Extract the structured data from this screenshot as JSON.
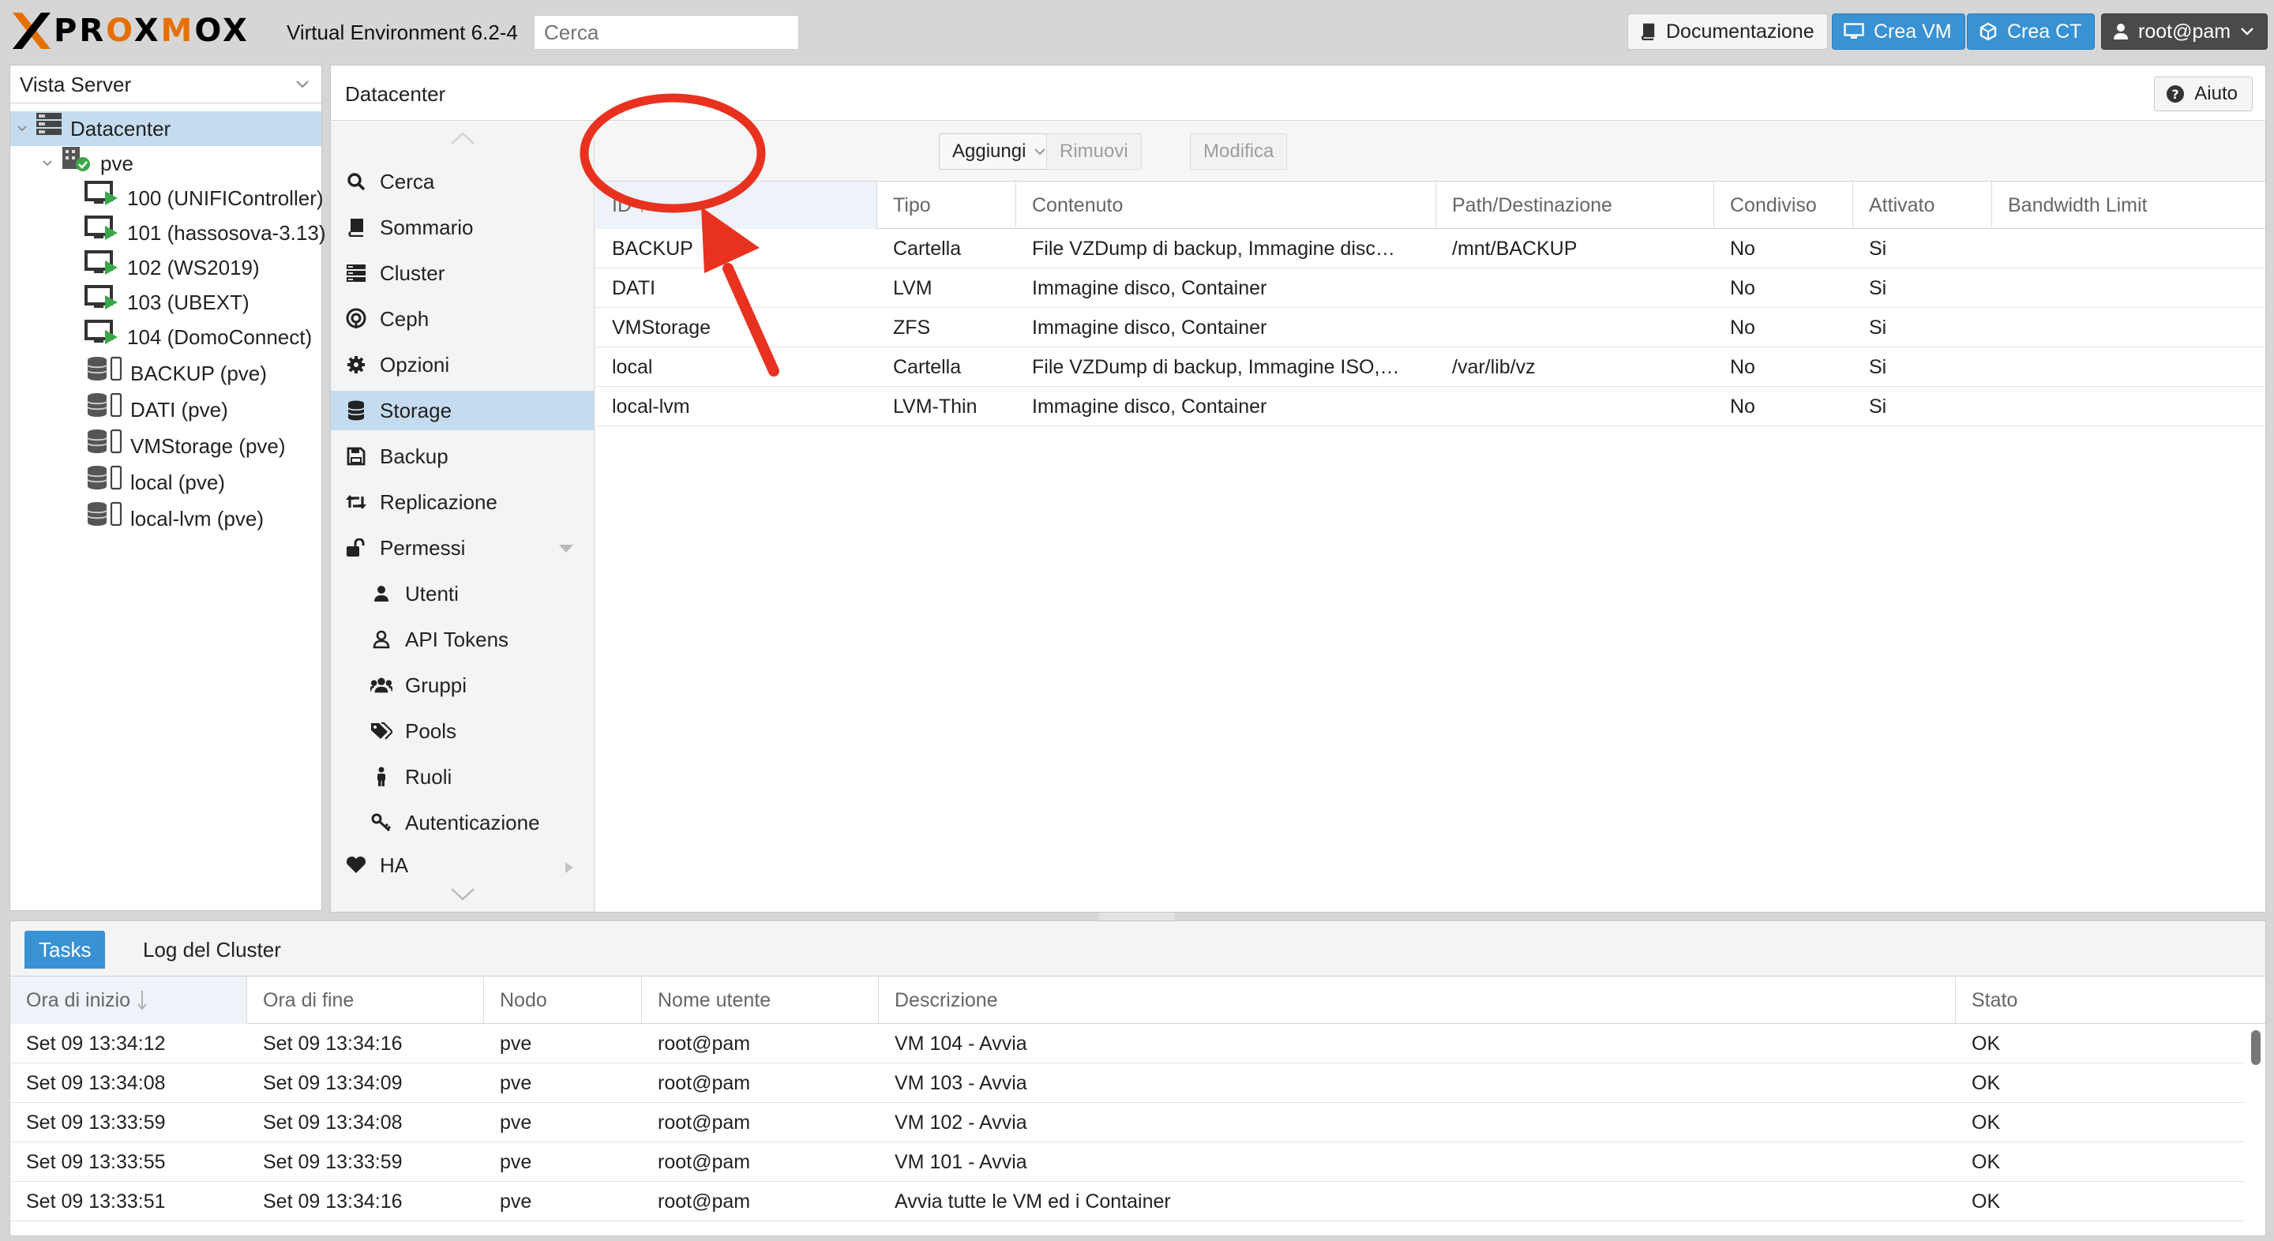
{
  "header": {
    "version": "Virtual Environment 6.2-4",
    "search_placeholder": "Cerca",
    "docs_label": "Documentazione",
    "create_vm_label": "Crea VM",
    "create_ct_label": "Crea CT",
    "user_label": "root@pam"
  },
  "sidebar": {
    "view_label": "Vista Server",
    "datacenter": "Datacenter",
    "node": "pve",
    "vms": [
      "100 (UNIFIController)",
      "101 (hassosova-3.13)",
      "102 (WS2019)",
      "103 (UBEXT)",
      "104 (DomoConnect)"
    ],
    "storages": [
      "BACKUP (pve)",
      "DATI (pve)",
      "VMStorage (pve)",
      "local (pve)",
      "local-lvm (pve)"
    ]
  },
  "main": {
    "title": "Datacenter",
    "help_label": "Aiuto",
    "menu": [
      {
        "label": "Cerca",
        "icon": "search-icon"
      },
      {
        "label": "Sommario",
        "icon": "book-icon"
      },
      {
        "label": "Cluster",
        "icon": "server-icon"
      },
      {
        "label": "Ceph",
        "icon": "ceph-icon"
      },
      {
        "label": "Opzioni",
        "icon": "gear-icon"
      },
      {
        "label": "Storage",
        "icon": "database-icon"
      },
      {
        "label": "Backup",
        "icon": "floppy-icon"
      },
      {
        "label": "Replicazione",
        "icon": "retweet-icon"
      },
      {
        "label": "Permessi",
        "icon": "unlock-icon"
      },
      {
        "label": "Utenti",
        "icon": "user-icon"
      },
      {
        "label": "API Tokens",
        "icon": "user-outline-icon"
      },
      {
        "label": "Gruppi",
        "icon": "users-icon"
      },
      {
        "label": "Pools",
        "icon": "tags-icon"
      },
      {
        "label": "Ruoli",
        "icon": "male-icon"
      },
      {
        "label": "Autenticazione",
        "icon": "key-icon"
      },
      {
        "label": "HA",
        "icon": "heartbeat-icon"
      }
    ],
    "toolbar": {
      "add_label": "Aggiungi",
      "remove_label": "Rimuovi",
      "edit_label": "Modifica"
    },
    "storage_table": {
      "columns": [
        "ID ↑",
        "Tipo",
        "Contenuto",
        "Path/Destinazione",
        "Condiviso",
        "Attivato",
        "Bandwidth Limit"
      ],
      "rows": [
        [
          "BACKUP",
          "Cartella",
          "File VZDump di backup, Immagine disc…",
          "/mnt/BACKUP",
          "No",
          "Si",
          ""
        ],
        [
          "DATI",
          "LVM",
          "Immagine disco, Container",
          "",
          "No",
          "Si",
          ""
        ],
        [
          "VMStorage",
          "ZFS",
          "Immagine disco, Container",
          "",
          "No",
          "Si",
          ""
        ],
        [
          "local",
          "Cartella",
          "File VZDump di backup, Immagine ISO,…",
          "/var/lib/vz",
          "No",
          "Si",
          ""
        ],
        [
          "local-lvm",
          "LVM-Thin",
          "Immagine disco, Container",
          "",
          "No",
          "Si",
          ""
        ]
      ]
    }
  },
  "tasks": {
    "tab_tasks": "Tasks",
    "tab_cluster_log": "Log del Cluster",
    "columns": [
      "Ora di inizio",
      "Ora di fine",
      "Nodo",
      "Nome utente",
      "Descrizione",
      "Stato"
    ],
    "rows": [
      [
        "Set 09 13:34:12",
        "Set 09 13:34:16",
        "pve",
        "root@pam",
        "VM 104 - Avvia",
        "OK"
      ],
      [
        "Set 09 13:34:08",
        "Set 09 13:34:09",
        "pve",
        "root@pam",
        "VM 103 - Avvia",
        "OK"
      ],
      [
        "Set 09 13:33:59",
        "Set 09 13:34:08",
        "pve",
        "root@pam",
        "VM 102 - Avvia",
        "OK"
      ],
      [
        "Set 09 13:33:55",
        "Set 09 13:33:59",
        "pve",
        "root@pam",
        "VM 101 - Avvia",
        "OK"
      ],
      [
        "Set 09 13:33:51",
        "Set 09 13:34:16",
        "pve",
        "root@pam",
        "Avvia tutte le VM ed i Container",
        "OK"
      ]
    ]
  },
  "colors": {
    "accent": "#3892d4",
    "selection": "#c5dcf0",
    "annotation": "#e8321f",
    "brand_orange": "#e57000"
  }
}
